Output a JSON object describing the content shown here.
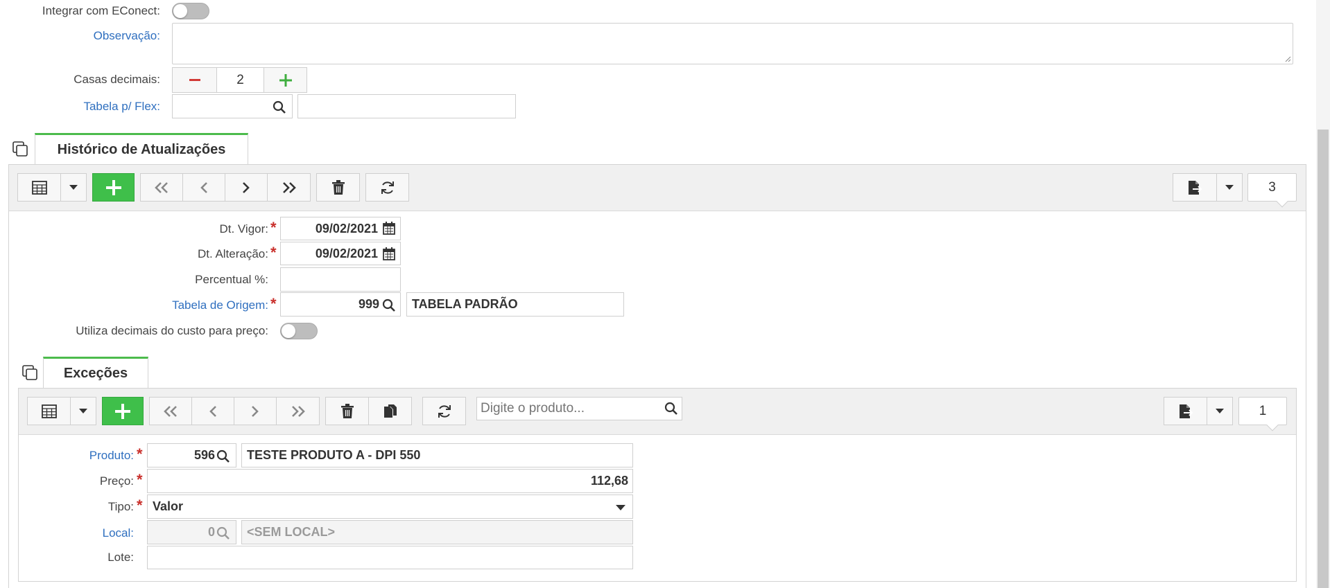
{
  "form": {
    "econect_label": "Integrar com EConect:",
    "observacao_label": "Observação:",
    "observacao_value": "",
    "casas_label": "Casas decimais:",
    "casas_value": "2",
    "tabela_flex_label": "Tabela p/ Flex:",
    "tabela_flex_code": "",
    "tabela_flex_desc": ""
  },
  "historico": {
    "tab_label": "Histórico de Atualizações",
    "record_count": "3",
    "dt_vigor_label": "Dt. Vigor:",
    "dt_vigor_value": "09/02/2021",
    "dt_alteracao_label": "Dt. Alteração:",
    "dt_alteracao_value": "09/02/2021",
    "percentual_label": "Percentual %:",
    "percentual_value": "",
    "tabela_origem_label": "Tabela de Origem:",
    "tabela_origem_code": "999",
    "tabela_origem_desc": "TABELA PADRÃO",
    "utiliza_decimais_label": "Utiliza decimais do custo para preço:"
  },
  "excecoes": {
    "tab_label": "Exceções",
    "record_count": "1",
    "search_placeholder": "Digite o produto...",
    "produto_label": "Produto:",
    "produto_code": "596",
    "produto_desc": "TESTE PRODUTO A - DPI 550",
    "preco_label": "Preço:",
    "preco_value": "112,68",
    "tipo_label": "Tipo:",
    "tipo_value": "Valor",
    "local_label": "Local:",
    "local_code": "0",
    "local_desc": "<SEM LOCAL>",
    "lote_label": "Lote:",
    "lote_value": ""
  },
  "colors": {
    "accent_green": "#3fbf4a",
    "link_blue": "#2f6fbf",
    "required_red": "#c9302c"
  }
}
